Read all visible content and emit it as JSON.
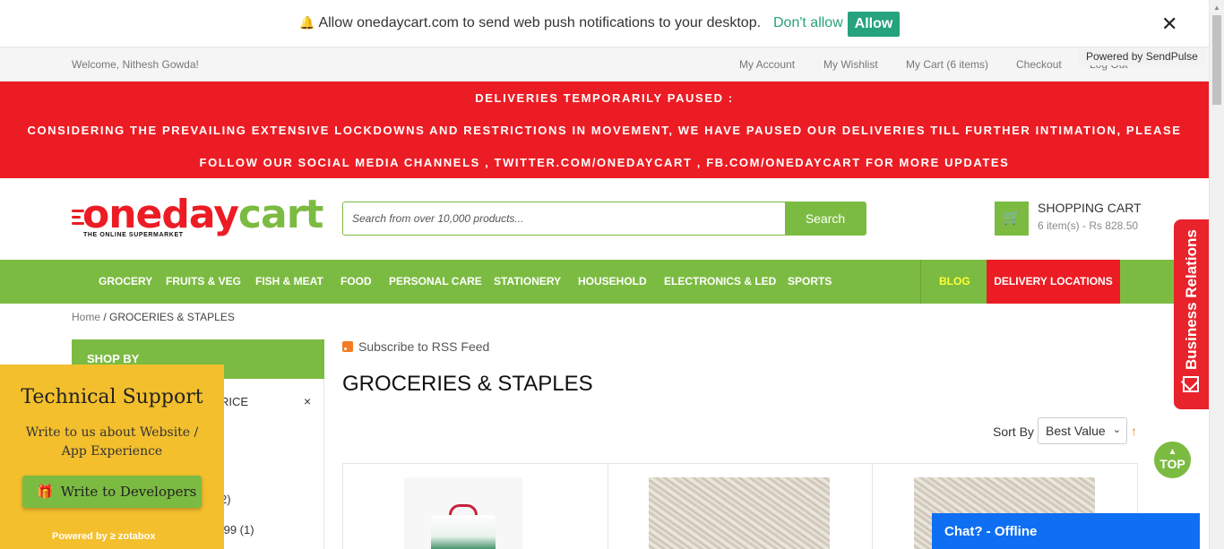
{
  "push": {
    "text": "Allow onedaycart.com to send web push notifications to your desktop.",
    "deny": "Don't allow",
    "allow": "Allow",
    "close": "✕",
    "powered": "Powered by SendPulse"
  },
  "toplinks": {
    "welcome": "Welcome, Nithesh Gowda!",
    "items": [
      "My Account",
      "My Wishlist",
      "My Cart (6 items)",
      "Checkout",
      "Log Out"
    ]
  },
  "notice": {
    "line1": "DELIVERIES TEMPORARILY PAUSED :",
    "line2": "CONSIDERING THE PREVAILING EXTENSIVE LOCKDOWNS AND RESTRICTIONS IN MOVEMENT, WE HAVE PAUSED OUR DELIVERIES TILL FURTHER INTIMATION, PLEASE",
    "line3": "FOLLOW OUR SOCIAL MEDIA CHANNELS , TWITTER.COM/ONEDAYCART , FB.COM/ONEDAYCART FOR MORE UPDATES"
  },
  "logo": {
    "part1": "oneday",
    "part2": "cart",
    "tagline": "THE ONLINE SUPERMARKET"
  },
  "search": {
    "placeholder": "Search from over 10,000 products...",
    "button": "Search"
  },
  "cart": {
    "title": "SHOPPING CART",
    "summary": "6 item(s) - Rs 828.50"
  },
  "nav": {
    "items": [
      "GROCERY",
      "FRUITS & VEG",
      "FISH & MEAT",
      "FOOD",
      "PERSONAL CARE",
      "STATIONERY",
      "HOUSEHOLD",
      "ELECTRONICS & LED",
      "SPORTS"
    ],
    "blog": "BLOG",
    "delivery": "DELIVERY LOCATIONS"
  },
  "breadcrumb": {
    "home": "Home",
    "sep": " / ",
    "current": "GROCERIES & STAPLES"
  },
  "sidebar": {
    "title": "SHOP BY",
    "filter": "RICE",
    "filter_remove": "×",
    "count1": "2)",
    "count2": ".99 (1)"
  },
  "main": {
    "rss": "Subscribe to RSS Feed",
    "title": "GROCERIES & STAPLES",
    "sort_label": "Sort By",
    "sort_value": "Best Value",
    "sort_dir": "↑"
  },
  "support": {
    "title": "Technical Support",
    "subtitle": "Write to us about Website / App Experience",
    "button": "Write to Developers",
    "powered": "Powered by ≥ zotabox"
  },
  "widgets": {
    "business": "Business Relations",
    "top": "TOP",
    "chat": "Chat? - Offline"
  },
  "colors": {
    "green": "#7cbb42",
    "red": "#ec1c24",
    "push_green": "#26a37c",
    "support_yellow": "#f3bf2d",
    "chat_blue": "#0f6ff2"
  }
}
